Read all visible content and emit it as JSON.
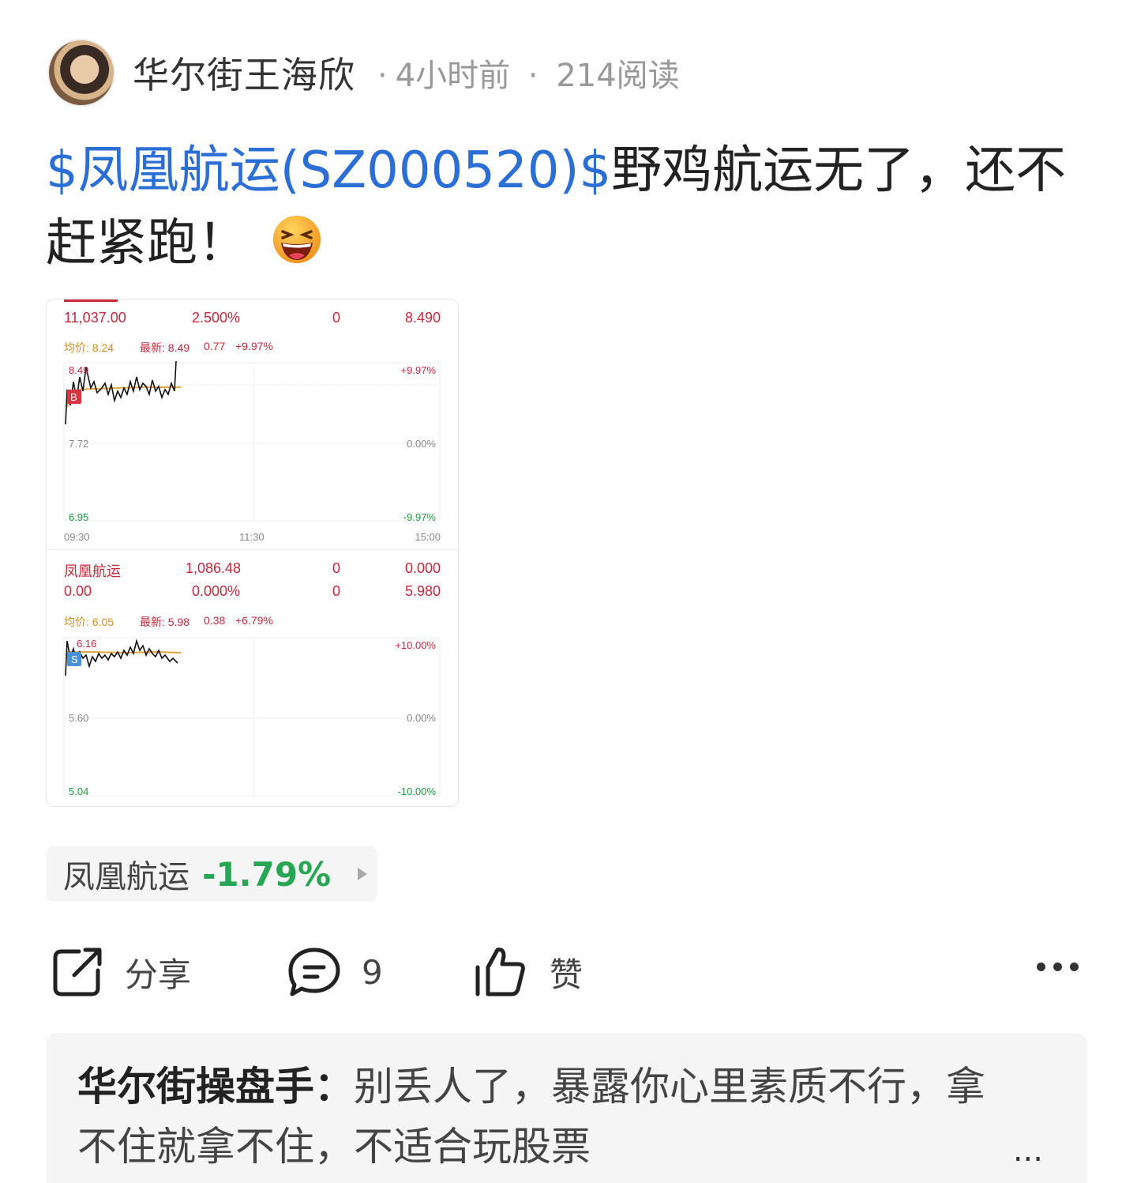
{
  "post": {
    "author": "华尔街王海欣",
    "time": "4小时前",
    "reads": "214阅读",
    "text_link": "$凤凰航运(SZ000520)$",
    "text_body": "野鸡航运无了，还不赶紧跑！"
  },
  "chart_image": {
    "top_partial_row": [
      "11,037.00",
      "2.500%",
      "0",
      "8.490"
    ],
    "panel1": {
      "avg_label": "均价: 8.24",
      "latest_label": "最新: 8.49",
      "change": "0.77",
      "pct": "+9.97%",
      "price_top": "8.49",
      "price_mid": "7.72",
      "price_bottom": "6.95",
      "pct_top": "+9.97%",
      "pct_mid": "0.00%",
      "pct_bottom": "-9.97%",
      "time_start": "09:30",
      "time_mid": "11:30",
      "time_end": "15:00",
      "marker": "B"
    },
    "row2": [
      "凤凰航运",
      "1,086.48",
      "0",
      "0.000"
    ],
    "row3": [
      "0.00",
      "0.000%",
      "0",
      "5.980"
    ],
    "panel2": {
      "avg_label": "均价: 6.05",
      "latest_label": "最新: 5.98",
      "change": "0.38",
      "pct": "+6.79%",
      "price_top": "6.16",
      "price_mid": "5.60",
      "price_bottom": "5.04",
      "pct_top": "+10.00%",
      "pct_mid": "0.00%",
      "pct_bottom": "-10.00%",
      "marker": "S"
    }
  },
  "stock_chip": {
    "name": "凤凰航运",
    "change": "-1.79%"
  },
  "actions": {
    "share": "分享",
    "comments": "9",
    "like": "赞"
  },
  "comment": {
    "author": "华尔街操盘手：",
    "text": "别丢人了，暴露你心里素质不行，拿不住就拿不住，不适合玩股票",
    "more": "..."
  },
  "colors": {
    "link": "#2b6fd6",
    "down": "#27a654",
    "up": "#c8283a"
  }
}
